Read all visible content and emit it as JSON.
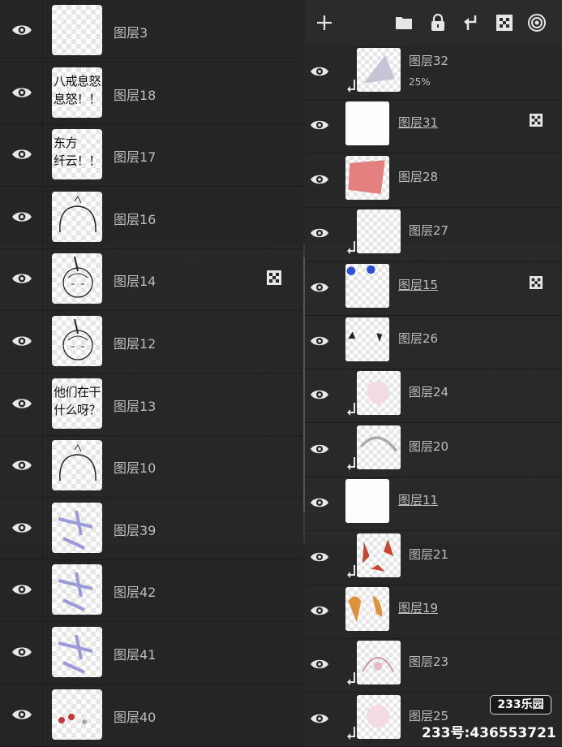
{
  "left_layers": [
    {
      "name": "图层3",
      "thumb": "blank",
      "thumb_text": "",
      "mask": false
    },
    {
      "name": "图层18",
      "thumb": "text",
      "thumb_text": "八戒息怒\n息怒！！",
      "mask": false
    },
    {
      "name": "图层17",
      "thumb": "text",
      "thumb_text": "东方\n纤云！！",
      "mask": false
    },
    {
      "name": "图层16",
      "thumb": "head-outline",
      "thumb_text": "",
      "mask": false
    },
    {
      "name": "图层14",
      "thumb": "character-sketch",
      "thumb_text": "",
      "mask": true
    },
    {
      "name": "图层12",
      "thumb": "character-sketch",
      "thumb_text": "",
      "mask": false
    },
    {
      "name": "图层13",
      "thumb": "text",
      "thumb_text": "他们在干\n什么呀？",
      "mask": false
    },
    {
      "name": "图层10",
      "thumb": "head-outline",
      "thumb_text": "",
      "mask": false
    },
    {
      "name": "图层39",
      "thumb": "purple-strokes",
      "thumb_text": "",
      "mask": false
    },
    {
      "name": "图层42",
      "thumb": "purple-strokes",
      "thumb_text": "",
      "mask": false
    },
    {
      "name": "图层41",
      "thumb": "purple-strokes",
      "thumb_text": "",
      "mask": false
    },
    {
      "name": "图层40",
      "thumb": "red-dots",
      "thumb_text": "",
      "mask": false
    }
  ],
  "toolbar": {
    "icons": [
      "add-icon",
      "folder-icon",
      "lock-icon",
      "merge-down-icon",
      "mask-icon",
      "layer-target-icon"
    ]
  },
  "right_layers": [
    {
      "name": "图层32",
      "sub": "25%",
      "clipped": true,
      "selected": false,
      "thumb": "gray-shape",
      "mask": false
    },
    {
      "name": "图层31",
      "sub": "",
      "clipped": false,
      "selected": true,
      "thumb": "white",
      "mask": true
    },
    {
      "name": "图层28",
      "sub": "",
      "clipped": false,
      "selected": false,
      "thumb": "pink-fill",
      "mask": false
    },
    {
      "name": "图层27",
      "sub": "",
      "clipped": true,
      "selected": false,
      "thumb": "blank",
      "mask": false
    },
    {
      "name": "图层15",
      "sub": "",
      "clipped": false,
      "selected": true,
      "thumb": "blue-dots",
      "mask": true
    },
    {
      "name": "图层26",
      "sub": "",
      "clipped": false,
      "selected": false,
      "thumb": "black-dots",
      "mask": false
    },
    {
      "name": "图层24",
      "sub": "",
      "clipped": true,
      "selected": false,
      "thumb": "faint-pink",
      "mask": false
    },
    {
      "name": "图层20",
      "sub": "",
      "clipped": true,
      "selected": false,
      "thumb": "gray-hair",
      "mask": false
    },
    {
      "name": "图层11",
      "sub": "",
      "clipped": false,
      "selected": true,
      "thumb": "white",
      "mask": false
    },
    {
      "name": "图层21",
      "sub": "",
      "clipped": true,
      "selected": false,
      "thumb": "red-shards",
      "mask": false
    },
    {
      "name": "图层19",
      "sub": "",
      "clipped": false,
      "selected": true,
      "thumb": "orange-shapes",
      "mask": false
    },
    {
      "name": "图层23",
      "sub": "",
      "clipped": true,
      "selected": false,
      "thumb": "pink-sketch",
      "mask": false
    },
    {
      "name": "图层25",
      "sub": "",
      "clipped": true,
      "selected": false,
      "thumb": "faint-pink",
      "mask": false
    }
  ],
  "watermark": {
    "logo": "233乐园",
    "id_text": "233号:436553721"
  },
  "colors": {
    "panel": "#262626",
    "text": "#bdbdbd",
    "icon": "#e6e6e6"
  }
}
